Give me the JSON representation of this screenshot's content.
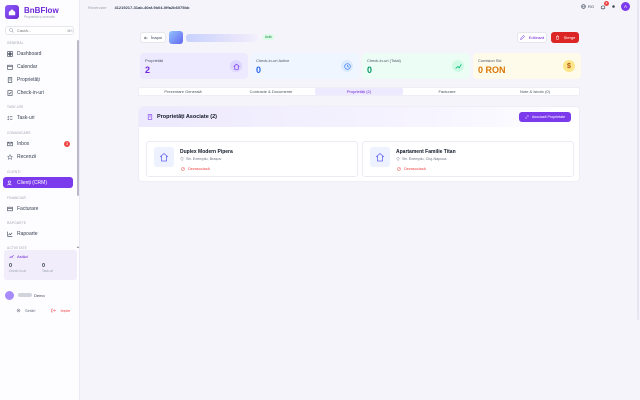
{
  "app": {
    "name": "BnBFlow",
    "tagline": "Proprietăți și rezervări"
  },
  "sidebar": {
    "search": {
      "placeholder": "Caută...",
      "shortcut": "⌘K"
    },
    "sections": {
      "general": "GENERAL",
      "tasks": "TASK-URI",
      "communication": "COMUNICARE",
      "clients": "CLIENȚI",
      "financial": "FINANCIAR",
      "reports": "RAPOARTE",
      "activity": "ACTIVITATE"
    },
    "items": {
      "dashboard": "Dashboard",
      "calendar": "Calendar",
      "properties": "Proprietăți",
      "checkins": "Check-in-uri",
      "tasks": "Task-uri",
      "inbox": "Inbox",
      "reviews": "Recenzii",
      "clients": "Clienți (CRM)",
      "invoices": "Facturare",
      "reports": "Rapoarte"
    },
    "inbox_badge": "3",
    "activity": {
      "title": "Astăzi",
      "checkins_value": "0",
      "checkins_label": "Check-in-uri",
      "tasks_value": "0",
      "tasks_label": "Task-uri"
    },
    "user": {
      "name": "Demo"
    },
    "footer": {
      "settings": "Setări",
      "logout": "Ieșire"
    }
  },
  "topbar": {
    "path": "Rezervare",
    "id": "41219217-31ab-40af-9b04-0ffa2b6075bb",
    "lang": "RO",
    "notif_count": "6",
    "avatar_initial": "A"
  },
  "header": {
    "back_label": "Înapoi",
    "status": "Activ",
    "edit_label": "Editează",
    "delete_label": "Șterge"
  },
  "stats": [
    {
      "label": "Proprietăți",
      "value": "2",
      "color": "#ede9fe",
      "icon_color": "#7c3aed"
    },
    {
      "label": "Check-in-uri Active",
      "value": "0",
      "color": "#eff6ff",
      "icon_color": "#3b82f6"
    },
    {
      "label": "Check-in-uri (Total)",
      "value": "0",
      "color": "#ecfdf5",
      "icon_color": "#10b981"
    },
    {
      "label": "Comision Ski",
      "value": "0 RON",
      "color": "#fffbeb",
      "icon_color": "#f59e0b"
    }
  ],
  "tabs": [
    {
      "label": "Prezentare Generală",
      "active": false
    },
    {
      "label": "Contracte & Documente",
      "active": false
    },
    {
      "label": "Proprietăți (2)",
      "active": true
    },
    {
      "label": "Facturare",
      "active": false
    },
    {
      "label": "Note & Istoric (0)",
      "active": false
    }
  ],
  "panel": {
    "title": "Proprietăți Asociate (2)",
    "add_label": "Asociază Proprietate"
  },
  "properties": [
    {
      "name": "Duplex Modern Pipera",
      "location": "Str. Exemplu, Brașov",
      "action": "Dezasociază"
    },
    {
      "name": "Apartament Familie Titan",
      "location": "Str. Exemplu, Cluj-Napoca",
      "action": "Dezasociază"
    }
  ],
  "colors": {
    "accent": "#7c3aed",
    "danger": "#dc2626",
    "success": "#15803d"
  }
}
